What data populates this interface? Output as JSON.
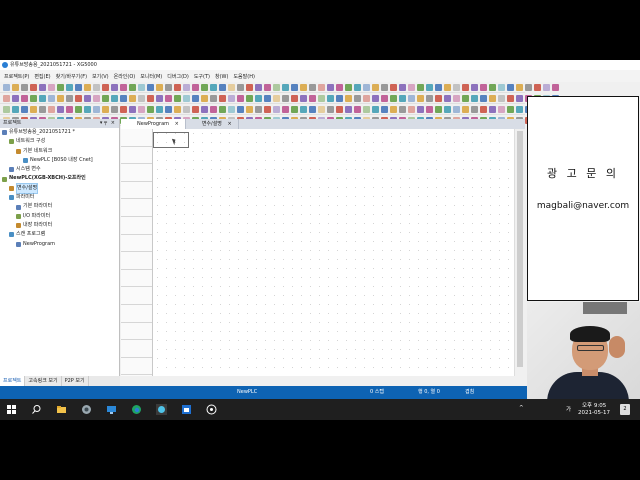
{
  "window": {
    "title": "유튜브방송용_2021051721 - XG5000"
  },
  "menu": [
    "프로젝트(P)",
    "편집(E)",
    "찾기/바꾸기(F)",
    "보기(V)",
    "온라인(O)",
    "모니터(M)",
    "디버그(D)",
    "도구(T)",
    "창(W)",
    "도움말(H)"
  ],
  "project_panel": {
    "title": "프로젝트",
    "tree": [
      {
        "label": "유튜브방송용_2021051721 *",
        "indent": 0,
        "bold": false
      },
      {
        "label": "네트워크 구성",
        "indent": 1,
        "bold": false
      },
      {
        "label": "기본 네트워크",
        "indent": 2,
        "bold": false
      },
      {
        "label": "NewPLC [B0S0 내장 Cnet]",
        "indent": 3,
        "bold": false
      },
      {
        "label": "시스템 변수",
        "indent": 1,
        "bold": false
      },
      {
        "label": "NewPLC(XGB-XBCH)-오프라인",
        "indent": 0,
        "bold": true
      },
      {
        "label": "변수/설명",
        "indent": 1,
        "bold": false,
        "selected": true
      },
      {
        "label": "파라미터",
        "indent": 1,
        "bold": false
      },
      {
        "label": "기본 파라미터",
        "indent": 2,
        "bold": false
      },
      {
        "label": "I/O 파라미터",
        "indent": 2,
        "bold": false
      },
      {
        "label": "내장 파라미터",
        "indent": 2,
        "bold": false
      },
      {
        "label": "스캔 프로그램",
        "indent": 1,
        "bold": false
      },
      {
        "label": "NewProgram",
        "indent": 2,
        "bold": false
      }
    ],
    "bottom_tabs": [
      "프로젝트",
      "고속링크 보기",
      "P2P 보기"
    ]
  },
  "editor_tabs": [
    {
      "label": "NewProgram",
      "close": "×",
      "active": true
    },
    {
      "label": "변수/설명",
      "close": "×",
      "active": false
    }
  ],
  "status": {
    "plc": "NewPLC",
    "step": "0 스텝",
    "position": "행 0, 열 0",
    "mode": "겹침"
  },
  "ad": {
    "title": "광 고 문 의",
    "email": "magbali@naver.com"
  },
  "taskbar": {
    "ime": "가",
    "time": "오후 9:05",
    "date": "2021-05-17",
    "notifications": "2",
    "tray_chevron": "^"
  },
  "colors": {
    "statusbar": "#0e63b3",
    "taskbar": "#1f1f1f",
    "tab_selected": "#ffffff"
  }
}
